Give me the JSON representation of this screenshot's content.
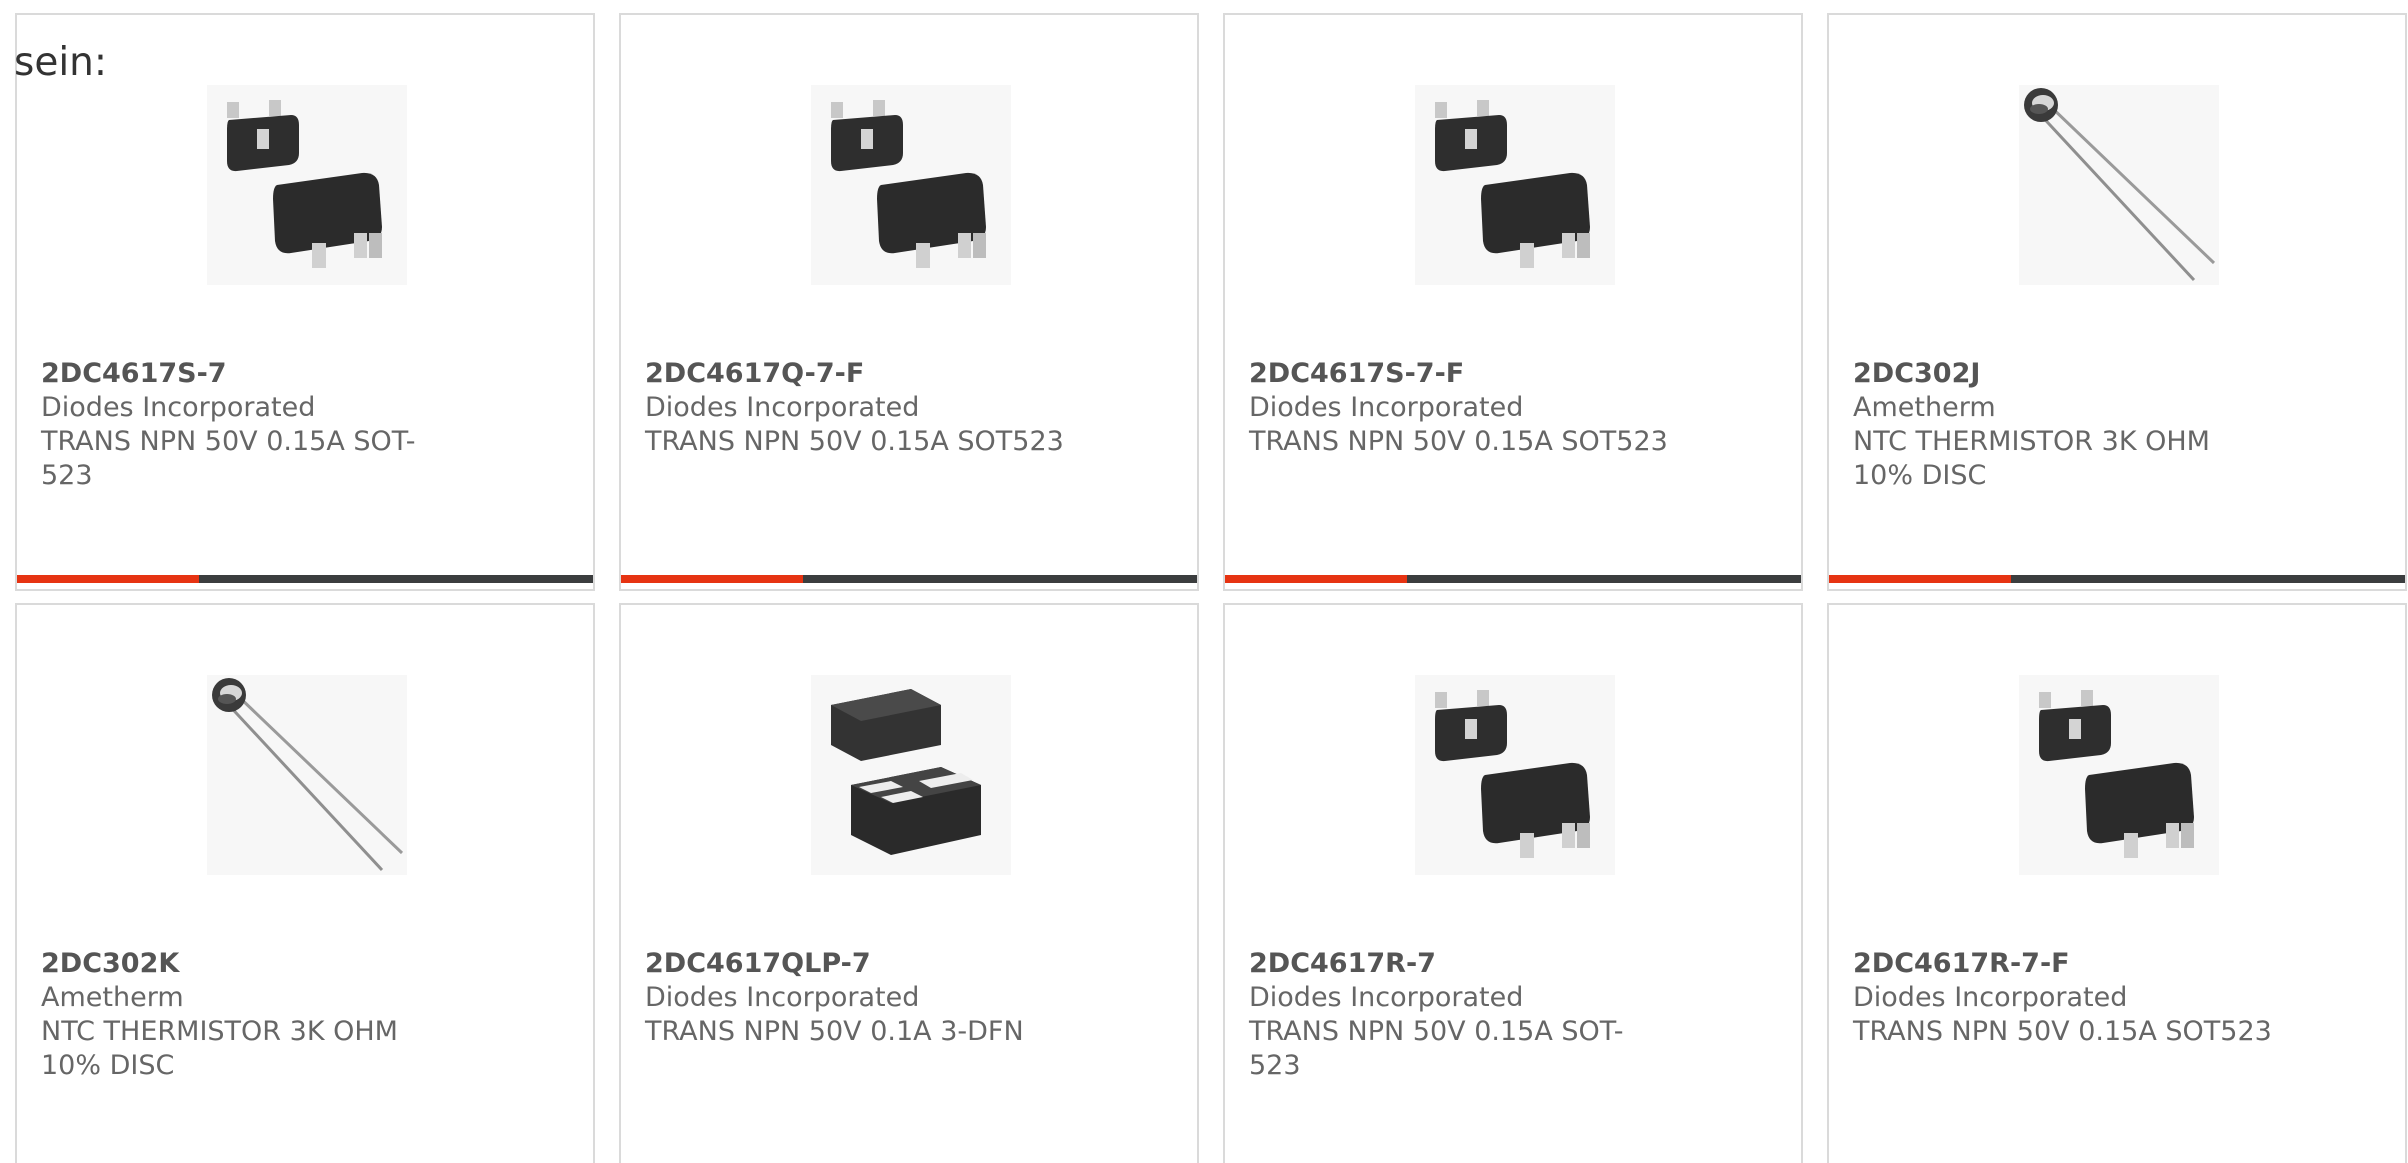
{
  "intro_text": "sein:",
  "colors": {
    "accent": "#e63312",
    "bar_dark": "#3b3d3e",
    "card_border": "#dadada",
    "text_gray": "#666666"
  },
  "products": [
    {
      "part": "2DC4617S-7",
      "manufacturer": "Diodes Incorporated",
      "description": "TRANS NPN 50V 0.15A SOT-523",
      "image_icon": "sot523-package-icon",
      "has_progress_bar": true
    },
    {
      "part": "2DC4617Q-7-F",
      "manufacturer": "Diodes Incorporated",
      "description": "TRANS NPN 50V 0.15A SOT523",
      "image_icon": "sot523-package-icon",
      "has_progress_bar": true
    },
    {
      "part": "2DC4617S-7-F",
      "manufacturer": "Diodes Incorporated",
      "description": "TRANS NPN 50V 0.15A SOT523",
      "image_icon": "sot523-package-icon",
      "has_progress_bar": true
    },
    {
      "part": "2DC302J",
      "manufacturer": "Ametherm",
      "description": "NTC THERMISTOR 3K OHM 10% DISC",
      "image_icon": "disc-thermistor-icon",
      "has_progress_bar": true
    },
    {
      "part": "2DC302K",
      "manufacturer": "Ametherm",
      "description": "NTC THERMISTOR 3K OHM 10% DISC",
      "image_icon": "disc-thermistor-icon",
      "has_progress_bar": false
    },
    {
      "part": "2DC4617QLP-7",
      "manufacturer": "Diodes Incorporated",
      "description": "TRANS NPN 50V 0.1A 3-DFN",
      "image_icon": "dfn-package-icon",
      "has_progress_bar": false
    },
    {
      "part": "2DC4617R-7",
      "manufacturer": "Diodes Incorporated",
      "description": "TRANS NPN 50V 0.15A SOT-523",
      "image_icon": "sot523-package-icon",
      "has_progress_bar": false
    },
    {
      "part": "2DC4617R-7-F",
      "manufacturer": "Diodes Incorporated",
      "description": "TRANS NPN 50V 0.15A SOT523",
      "image_icon": "sot523-package-icon",
      "has_progress_bar": false
    }
  ]
}
